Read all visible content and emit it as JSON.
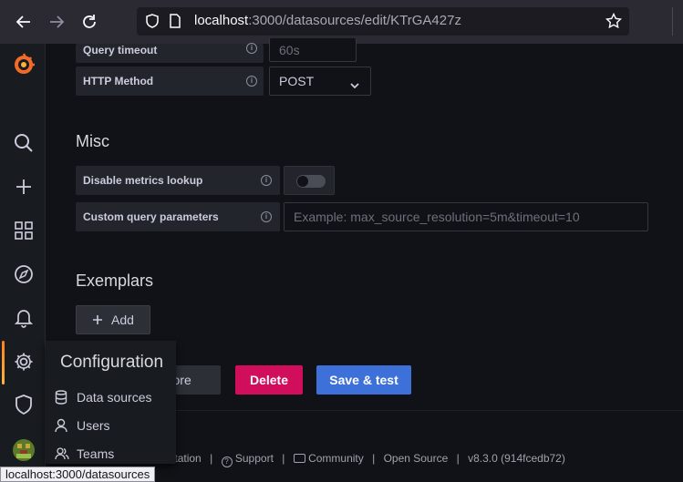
{
  "browser": {
    "url_host": "localhost",
    "url_rest": ":3000/datasources/edit/KTrGA427z",
    "status_url": "localhost:3000/datasources"
  },
  "http": {
    "query_timeout_label": "Query timeout",
    "query_timeout_value": "60s",
    "http_method_label": "HTTP Method",
    "http_method_value": "POST"
  },
  "misc": {
    "title": "Misc",
    "disable_metrics_label": "Disable metrics lookup",
    "disable_metrics_on": false,
    "custom_params_label": "Custom query parameters",
    "custom_params_placeholder": "Example: max_source_resolution=5m&timeout=10"
  },
  "exemplars": {
    "title": "Exemplars",
    "add_label": "Add"
  },
  "actions": {
    "explore_label": "Explore",
    "delete_label": "Delete",
    "save_label": "Save & test"
  },
  "colors": {
    "delete": "#d10e5c",
    "save": "#3d71d9",
    "accent": "#f5a623"
  },
  "config_menu": {
    "title": "Configuration",
    "items": [
      {
        "label": "Data sources",
        "icon": "database-icon"
      },
      {
        "label": "Users",
        "icon": "user-icon"
      },
      {
        "label": "Teams",
        "icon": "teams-icon"
      }
    ]
  },
  "footer": {
    "documentation": "Documentation",
    "support": "Support",
    "community": "Community",
    "open_source": "Open Source",
    "version": "v8.3.0 (914fcedb72)"
  }
}
